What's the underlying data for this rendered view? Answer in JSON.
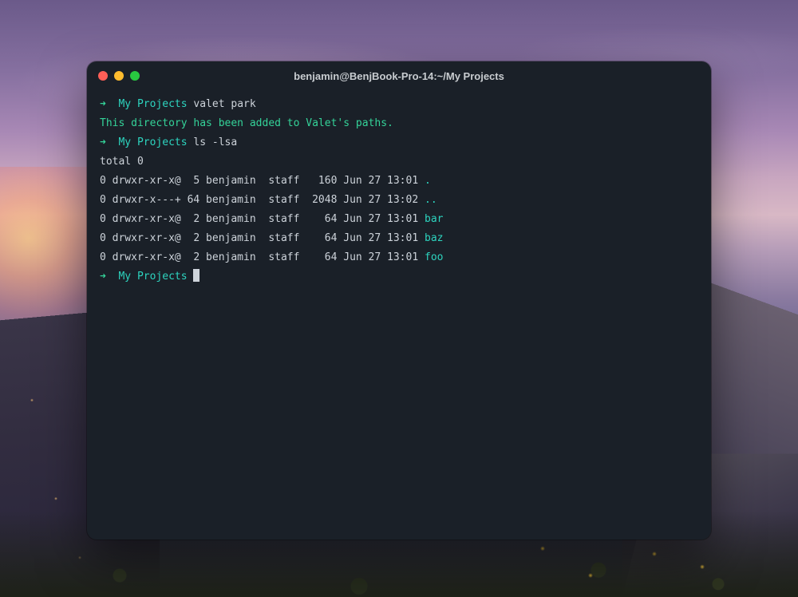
{
  "window": {
    "title": "benjamin@BenjBook-Pro-14:~/My Projects"
  },
  "prompt": {
    "arrow": "➜",
    "dir": "My Projects"
  },
  "commands": {
    "cmd1": "valet park",
    "cmd1_output": "This directory has been added to Valet's paths.",
    "cmd2": "ls -lsa",
    "total": "total 0"
  },
  "listing": [
    {
      "blocks": "0",
      "perms": "drwxr-xr-x@",
      "links": " 5",
      "owner": "benjamin",
      "group": "staff",
      "size": "  160",
      "date": "Jun 27 13:01",
      "name": "."
    },
    {
      "blocks": "0",
      "perms": "drwxr-x---+",
      "links": "64",
      "owner": "benjamin",
      "group": "staff",
      "size": " 2048",
      "date": "Jun 27 13:02",
      "name": ".."
    },
    {
      "blocks": "0",
      "perms": "drwxr-xr-x@",
      "links": " 2",
      "owner": "benjamin",
      "group": "staff",
      "size": "   64",
      "date": "Jun 27 13:01",
      "name": "bar"
    },
    {
      "blocks": "0",
      "perms": "drwxr-xr-x@",
      "links": " 2",
      "owner": "benjamin",
      "group": "staff",
      "size": "   64",
      "date": "Jun 27 13:01",
      "name": "baz"
    },
    {
      "blocks": "0",
      "perms": "drwxr-xr-x@",
      "links": " 2",
      "owner": "benjamin",
      "group": "staff",
      "size": "   64",
      "date": "Jun 27 13:01",
      "name": "foo"
    }
  ]
}
